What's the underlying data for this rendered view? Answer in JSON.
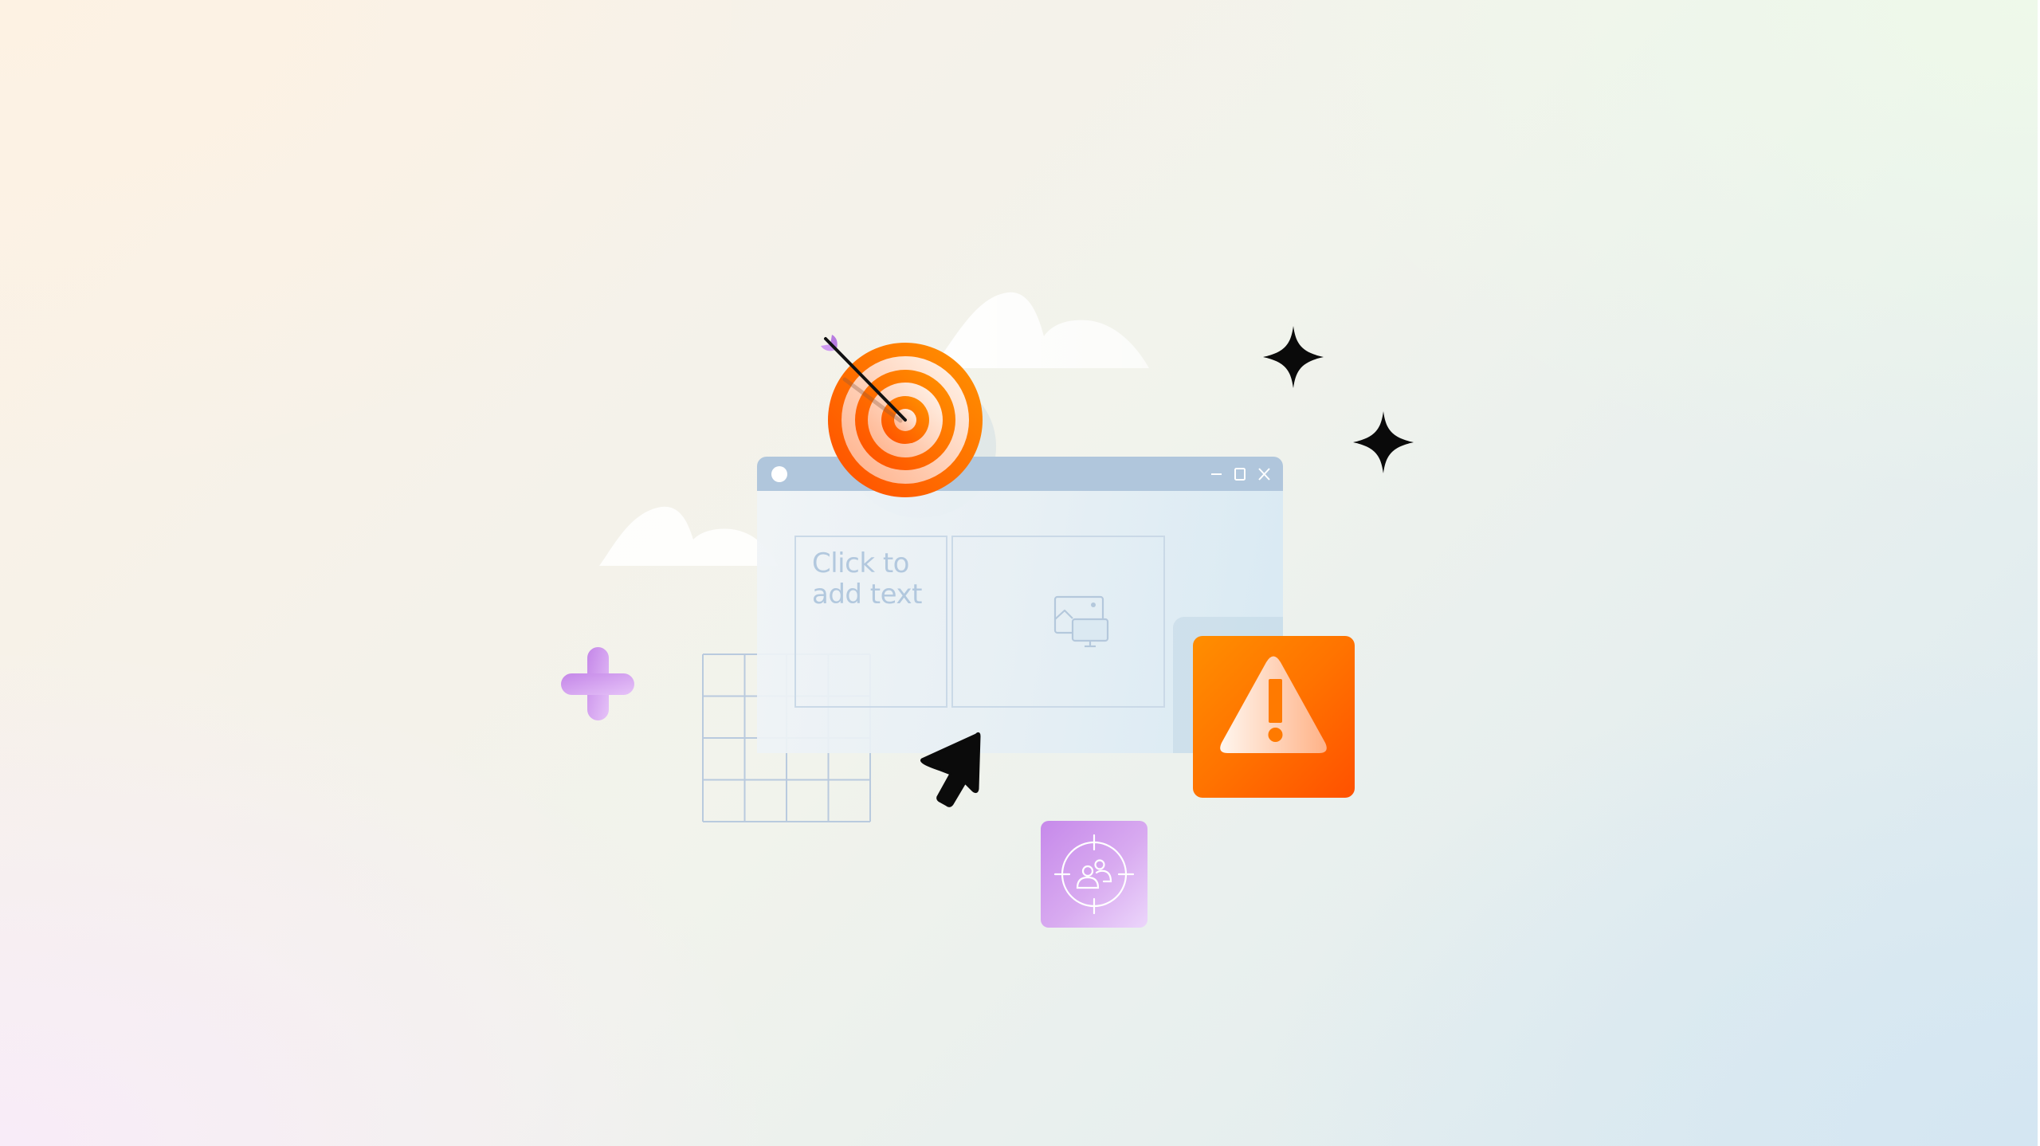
{
  "scene": {
    "description": "Illustration of a presentation slide window with a target, warning and audience icons",
    "background_colors": {
      "top_left": "#fdf2e3",
      "top_right": "#eef9ea",
      "bottom_left": "#f8ecf8",
      "bottom_right": "#d4e6f2"
    }
  },
  "window": {
    "titlebar_color": "#b0c6dc",
    "controls": {
      "minimize": "minimize-icon",
      "maximize": "maximize-icon",
      "close": "close-icon"
    },
    "text_placeholder": {
      "line1": "Click to",
      "line2": "add text"
    },
    "image_placeholder_icon": "image-monitor-icon"
  },
  "icons": {
    "target": {
      "name": "target-with-arrow-icon",
      "colors": [
        "#ff5a00",
        "#ff8c00",
        "#ffe9dc"
      ]
    },
    "warning": {
      "name": "warning-triangle-icon",
      "color": "#ff7300"
    },
    "audience": {
      "name": "audience-target-icon",
      "color": "#c98cec"
    },
    "plus": {
      "name": "plus-icon",
      "color": "#cf95ee"
    },
    "sparkles": [
      "sparkle-icon",
      "sparkle-icon"
    ],
    "cursor": "mouse-cursor-icon",
    "grid": "table-grid-icon",
    "clouds": [
      "cloud-icon",
      "cloud-icon"
    ]
  }
}
